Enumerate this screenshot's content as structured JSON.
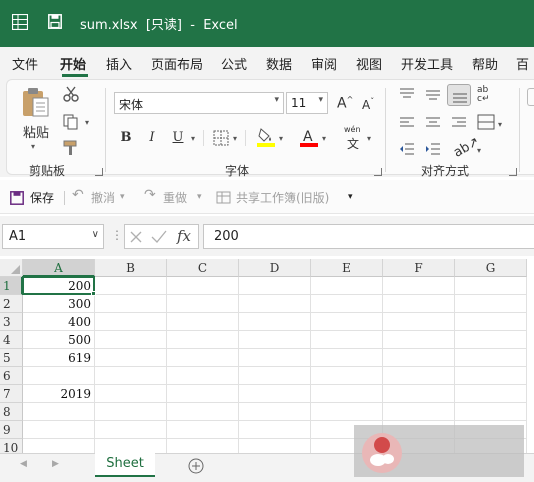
{
  "window": {
    "title": "sum.xlsx  [只读]  -  Excel"
  },
  "menu": {
    "tabs": [
      "文件",
      "开始",
      "插入",
      "页面布局",
      "公式",
      "数据",
      "审阅",
      "视图",
      "开发工具",
      "帮助",
      "百"
    ],
    "active_index": 1
  },
  "ribbon": {
    "clipboard": {
      "paste_label": "粘贴",
      "group_label": "剪贴板"
    },
    "font": {
      "name": "宋体",
      "size": "11",
      "bold": "B",
      "italic": "I",
      "underline": "U",
      "wen": "wén",
      "wen_char": "文",
      "group_label": "字体",
      "highlight_color": "#ffff00",
      "font_color": "#ff0000"
    },
    "alignment": {
      "group_label": "对齐方式"
    }
  },
  "quick_access": {
    "save": "保存",
    "undo": "撤消",
    "redo": "重做",
    "share": "共享工作簿(旧版)"
  },
  "formula_bar": {
    "name_box": "A1",
    "fx": "fx",
    "content": "200"
  },
  "sheet": {
    "columns": [
      "A",
      "B",
      "C",
      "D",
      "E",
      "F",
      "G"
    ],
    "rows": [
      "1",
      "2",
      "3",
      "4",
      "5",
      "6",
      "7",
      "8",
      "9",
      "10"
    ],
    "column_a_values": [
      "200",
      "300",
      "400",
      "500",
      "619",
      "",
      "2019",
      "",
      "",
      ""
    ],
    "active_cell": "A1"
  },
  "tabs": {
    "sheet_name": "Sheet",
    "add_icon": "plus-circle-icon"
  },
  "colors": {
    "accent": "#217346"
  }
}
